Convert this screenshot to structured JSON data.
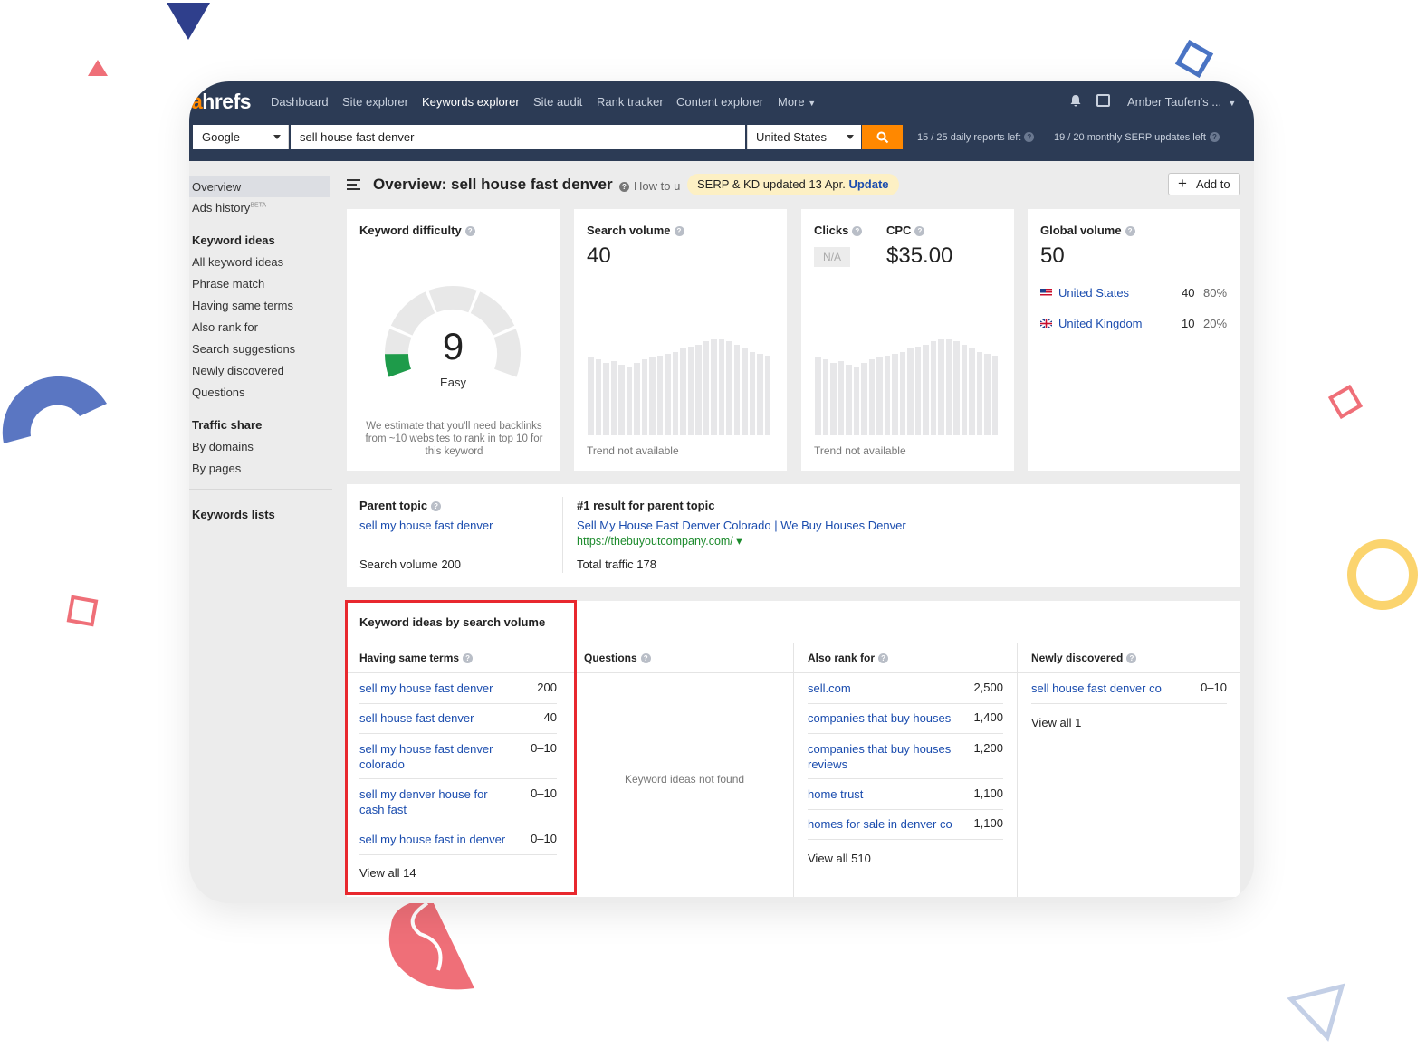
{
  "app": {
    "logo_prefix": "a",
    "logo_rest": "hrefs"
  },
  "nav": {
    "items": [
      "Dashboard",
      "Site explorer",
      "Keywords explorer",
      "Site audit",
      "Rank tracker",
      "Content explorer",
      "More"
    ],
    "active": "Keywords explorer",
    "user": "Amber Taufen's ..."
  },
  "search": {
    "engine": "Google",
    "query": "sell house fast denver",
    "country": "United States",
    "daily_limit": "15 / 25 daily reports left",
    "monthly_limit": "19 / 20 monthly SERP updates left"
  },
  "sidebar": {
    "overview": "Overview",
    "ads_history": "Ads history",
    "ads_history_badge": "BETA",
    "keyword_ideas_head": "Keyword ideas",
    "keyword_ideas": [
      "All keyword ideas",
      "Phrase match",
      "Having same terms",
      "Also rank for",
      "Search suggestions",
      "Newly discovered",
      "Questions"
    ],
    "traffic_share_head": "Traffic share",
    "traffic_share": [
      "By domains",
      "By pages"
    ],
    "keywords_lists": "Keywords lists"
  },
  "header": {
    "title": "Overview: sell house fast denver",
    "how_to": "How to u",
    "updated_text": "SERP & KD updated 13 Apr.",
    "update_link": "Update",
    "add_to": "Add to"
  },
  "difficulty": {
    "title": "Keyword difficulty",
    "value": "9",
    "label": "Easy",
    "score_fraction": 0.09,
    "note": "We estimate that you'll need backlinks from ~10 websites to rank in top 10 for this keyword",
    "color": "#1e9b4a"
  },
  "search_volume": {
    "title": "Search volume",
    "value": "40",
    "trend_note": "Trend not available"
  },
  "clicks": {
    "title": "Clicks",
    "value": "N/A",
    "trend_note": "Trend not available"
  },
  "cpc": {
    "title": "CPC",
    "value": "$35.00"
  },
  "global_volume": {
    "title": "Global volume",
    "value": "50",
    "countries": [
      {
        "name": "United States",
        "volume": "40",
        "share": "80%"
      },
      {
        "name": "United Kingdom",
        "volume": "10",
        "share": "20%"
      }
    ]
  },
  "parent_topic": {
    "title": "Parent topic",
    "keyword": "sell my house fast denver",
    "volume_text": "Search volume 200",
    "result_title": "#1 result for parent topic",
    "result_link": "Sell My House Fast Denver Colorado | We Buy Houses Denver",
    "result_url": "https://thebuyoutcompany.com/ ▾",
    "traffic_text": "Total traffic 178"
  },
  "ideas": {
    "title": "Keyword ideas by search volume",
    "same_terms": {
      "title": "Having same terms",
      "rows": [
        {
          "kw": "sell my house fast denver",
          "vol": "200"
        },
        {
          "kw": "sell house fast denver",
          "vol": "40"
        },
        {
          "kw": "sell my house fast denver colorado",
          "vol": "0–10"
        },
        {
          "kw": "sell my denver house for cash fast",
          "vol": "0–10"
        },
        {
          "kw": "sell my house fast in denver",
          "vol": "0–10"
        }
      ],
      "view_all": "View all 14"
    },
    "questions": {
      "title": "Questions",
      "empty": "Keyword ideas not found"
    },
    "also_rank": {
      "title": "Also rank for",
      "rows": [
        {
          "kw": "sell.com",
          "vol": "2,500"
        },
        {
          "kw": "companies that buy houses",
          "vol": "1,400"
        },
        {
          "kw": "companies that buy houses reviews",
          "vol": "1,200"
        },
        {
          "kw": "home trust",
          "vol": "1,100"
        },
        {
          "kw": "homes for sale in denver co",
          "vol": "1,100"
        }
      ],
      "view_all": "View all 510"
    },
    "newly": {
      "title": "Newly discovered",
      "rows": [
        {
          "kw": "sell house fast denver co",
          "vol": "0–10"
        }
      ],
      "view_all": "View all 1"
    }
  },
  "colors": {
    "nav_bg": "#2c3b55",
    "accent": "#ff8800",
    "link": "#1a4cae",
    "highlight": "#e8282e"
  }
}
